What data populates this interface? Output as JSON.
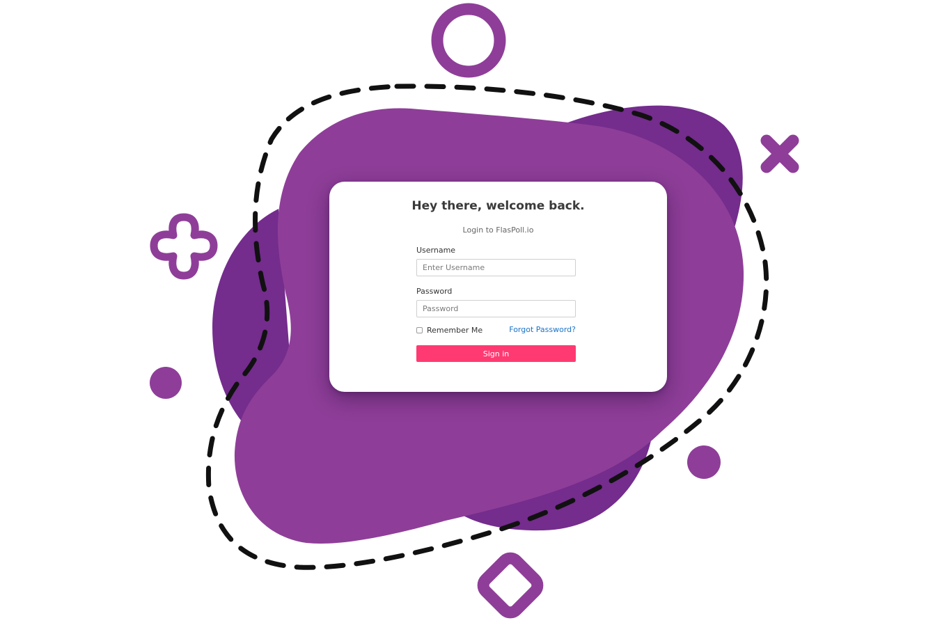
{
  "colors": {
    "brand_purple": "#8e3e98",
    "dark_purple": "#742c8d",
    "dashed_outline": "#111111",
    "submit_button": "#ff3a72",
    "link": "#1a73c8"
  },
  "decorations": {
    "icons": [
      "ring-icon",
      "x-cross-icon",
      "plus-outline-icon",
      "dot-icon",
      "dot-icon",
      "diamond-outline-icon"
    ]
  },
  "login": {
    "title": "Hey there, welcome back.",
    "subtitle": "Login to FlasPoll.io",
    "username": {
      "label": "Username",
      "placeholder": "Enter Username",
      "value": ""
    },
    "password": {
      "label": "Password",
      "placeholder": "Password",
      "value": ""
    },
    "remember_label": "Remember Me",
    "remember_checked": false,
    "forgot_label": "Forgot Password?",
    "submit_label": "Sign in"
  }
}
